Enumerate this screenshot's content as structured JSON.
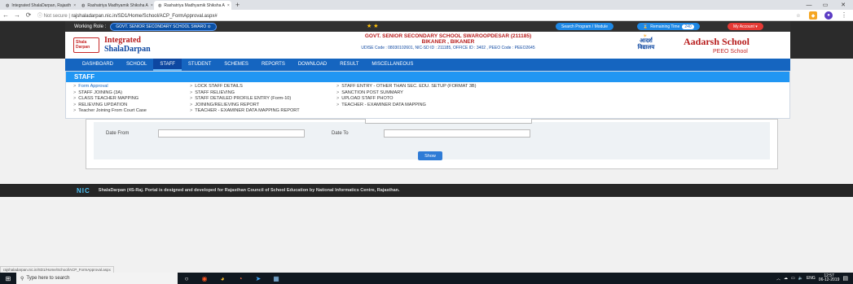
{
  "browser": {
    "tabs": [
      {
        "title": "Integrated ShalaDarpan, Rajasth",
        "close": "×"
      },
      {
        "title": "Rashatriya Madhyamik Shiksha A",
        "close": "×"
      },
      {
        "title": "Rashatriya Madhyamik Shiksha A",
        "close": "×"
      }
    ],
    "new_tab": "+",
    "url_prefix": "Not secure | ",
    "url": "rajshaladarpan.nic.in/SD1/Home/School/ACP_FormApproval.aspx#",
    "window_controls": [
      "—",
      "▭",
      "✕"
    ]
  },
  "header": {
    "role_label": "Working Role :",
    "role_value": "GOVT. SENIOR SECONDARY SCHOOL SWARO",
    "stars": "★ ★",
    "search_btn": "Search Program / Module",
    "remaining_btn": "Remaining Time",
    "remaining_value": "240",
    "account_btn": "My Account ▾",
    "logo_small": "Shala\nDarpan",
    "logo_title_1": "Integrated",
    "logo_title_2": "ShalaDarpan",
    "school_name": "GOVT. SENIOR SECONDARY SCHOOL SWAROOPDESAR (211185)",
    "school_location": "BIKANER , BIKANER",
    "udise_line": "UDISE Code : 08030102601,  NIC-SD ID : 211185,  OFFICE ID : 3402 , PEEO Code : PEEO2645",
    "adarsh_hindi": "आदर्श\nविद्यालय",
    "adarsh_title": "Aadarsh School",
    "adarsh_sub": "PEEO School"
  },
  "menu": {
    "items": [
      "DASHBOARD",
      "SCHOOL",
      "STAFF",
      "STUDENT",
      "SCHEMES",
      "REPORTS",
      "DOWNLOAD",
      "RESULT",
      "MISCELLANEOUS"
    ],
    "active": "STAFF"
  },
  "dropdown": {
    "heading": "STAFF",
    "col1": [
      "Form Approval",
      "STAFF JOINING (3A)",
      "CLASS TEACHER MAPPING",
      "RELIEVING UPDATION",
      "Teacher Joining From Court Case"
    ],
    "col2": [
      "LOCK STAFF DETAILS",
      "STAFF RELIEVING",
      "STAFF DETAILED PROFILE ENTRY (Form-10)",
      "JOINING/RELIEVING REPORT",
      "TEACHER - EXAMINER DATA MAPPING REPORT"
    ],
    "col3": [
      "STAFF ENTRY - OTHER THAN SEC. EDU. SETUP (FORMAT 3B)",
      "SANCTION POST SUMMARY",
      "UPLOAD STAFF PHOTO",
      "TEACHER - EXAMINER DATA MAPPING"
    ],
    "bullet": ">"
  },
  "form": {
    "date_from_label": "Date From",
    "date_to_label": "Date To",
    "show_button": "Show"
  },
  "footer": {
    "nic": "NIC",
    "text": "ShalaDarpan (4S-Raj. Portal is designed and developed for Rajasthan Council of School Education by National Informatics Centre, Rajasthan."
  },
  "status_url": "rajshaladarpan.nic.in/SD1/Home/School/ACP_FormApproval.aspx",
  "taskbar": {
    "search_placeholder": "Type here to search",
    "lang": "ENG",
    "time": "12:57",
    "date": "06-12-2019"
  }
}
